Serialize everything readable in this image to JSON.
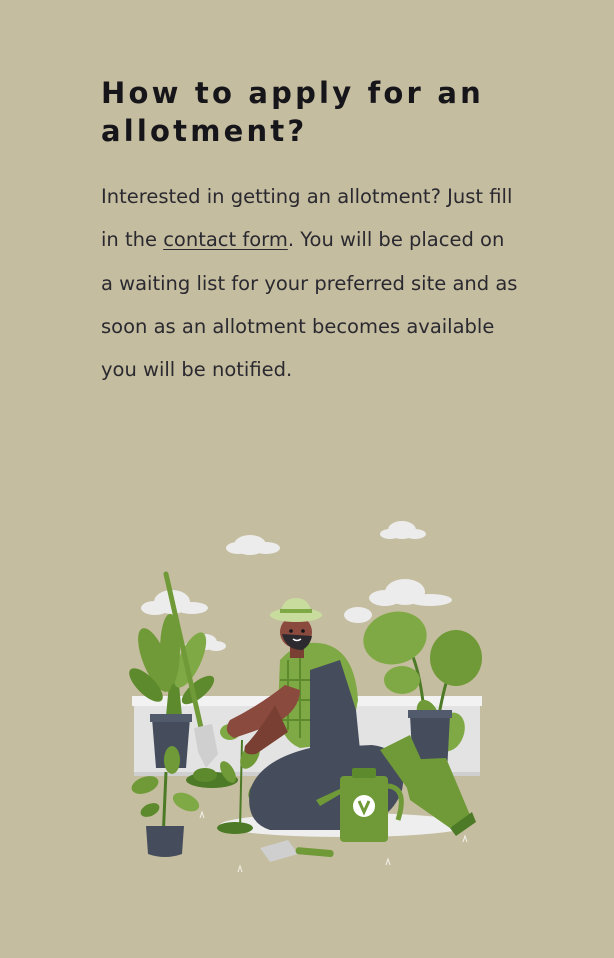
{
  "heading": "How to apply for an allotment?",
  "paragraph": {
    "before_link": "Interested in getting an allotment? Just fill in the ",
    "link_text": "contact form",
    "after_link": ". You will be placed on a waiting list for your preferred site and as soon as an allotment becomes available you will be notified."
  },
  "colors": {
    "background": "#c5bd9f",
    "text": "#2a2930",
    "heading": "#16151a",
    "plant_green": "#6f9a37",
    "dark_green": "#4c7a26",
    "slate": "#4a5568"
  }
}
